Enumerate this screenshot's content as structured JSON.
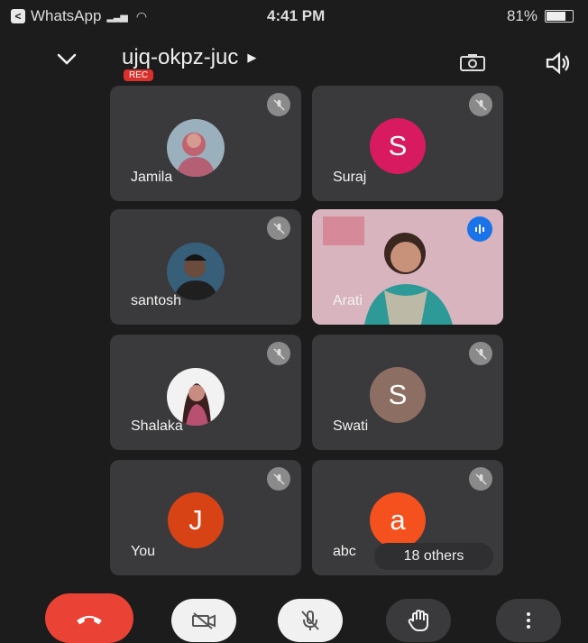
{
  "status_bar": {
    "app": "WhatsApp",
    "time": "4:41 PM",
    "battery": "81%",
    "battery_level": 0.81
  },
  "header": {
    "meeting_code": "ujq-okpz-juc",
    "rec_label": "REC"
  },
  "participants": [
    {
      "name": "Jamila",
      "type": "photo",
      "mic": "muted"
    },
    {
      "name": "Suraj",
      "type": "initial",
      "initial": "S",
      "color": "#d81b60",
      "mic": "muted"
    },
    {
      "name": "santosh",
      "type": "photo",
      "mic": "muted"
    },
    {
      "name": "Arati",
      "type": "video",
      "mic": "speaking"
    },
    {
      "name": "Shalaka",
      "type": "photo",
      "mic": "muted"
    },
    {
      "name": "Swati",
      "type": "initial",
      "initial": "S",
      "color": "#8d6e63",
      "mic": "muted"
    },
    {
      "name": "You",
      "type": "initial",
      "initial": "J",
      "color": "#d84315",
      "mic": "muted"
    },
    {
      "name": "abc",
      "type": "initial",
      "initial": "a",
      "color": "#f4511e",
      "mic": "muted"
    }
  ],
  "others_label": "18 others",
  "controls": {
    "end_call": "end-call",
    "camera": "video-off",
    "microphone": "mic-off",
    "raise_hand": "raise-hand",
    "more": "more-options"
  },
  "colors": {
    "background": "#1c1c1c",
    "tile": "#3a3a3c",
    "end_call": "#ea4335",
    "speaking": "#1a73e8"
  }
}
